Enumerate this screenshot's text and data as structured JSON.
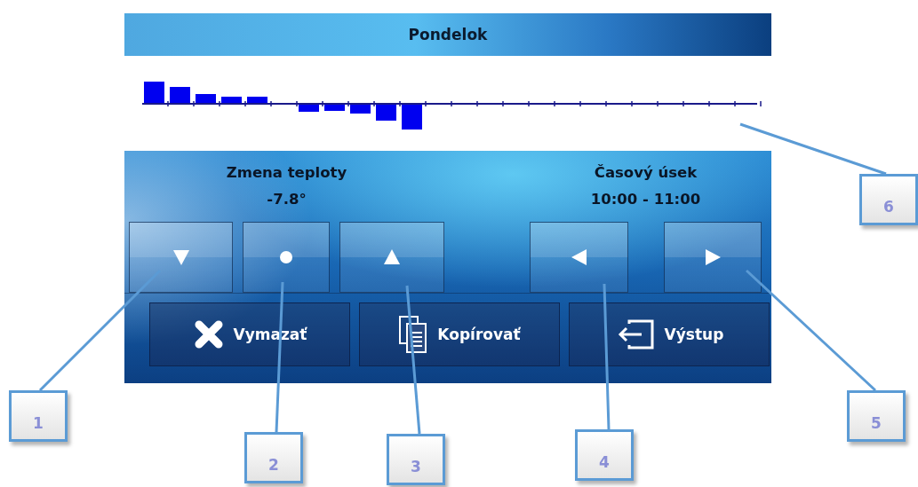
{
  "screen": {
    "title": "Pondelok",
    "temperature": {
      "label": "Zmena teploty",
      "value": "-7.8°"
    },
    "time_slot": {
      "label": "Časový úsek",
      "value": "10:00 - 11:00"
    },
    "bottom_buttons": [
      {
        "label": "Vymazať"
      },
      {
        "label": "Kopírovať"
      },
      {
        "label": "Výstup"
      }
    ]
  },
  "callouts": [
    {
      "label": "1"
    },
    {
      "label": "2"
    },
    {
      "label": "3"
    },
    {
      "label": "4"
    },
    {
      "label": "5"
    },
    {
      "label": "6"
    }
  ]
}
